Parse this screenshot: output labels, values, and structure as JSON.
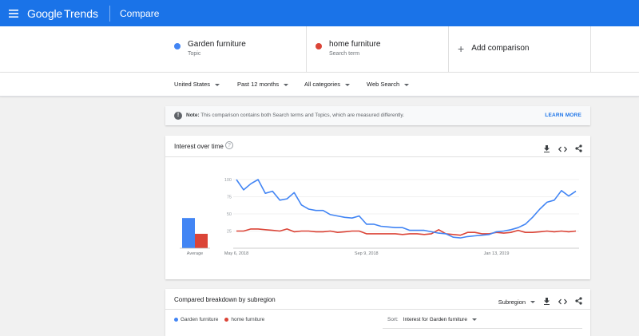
{
  "header": {
    "logo_google": "Google",
    "logo_trends": "Trends",
    "page_title": "Compare",
    "bg_color": "#1a73e8"
  },
  "terms": [
    {
      "name": "Garden furniture",
      "kind": "Topic",
      "color": "#4285f4"
    },
    {
      "name": "home furniture",
      "kind": "Search term",
      "color": "#db4437"
    }
  ],
  "add_comparison": "Add comparison",
  "filters": {
    "region": "United States",
    "period": "Past 12 months",
    "category": "All categories",
    "search_type": "Web Search"
  },
  "note": {
    "label": "Note:",
    "text": " This comparison contains both Search terms and Topics, which are measured differently.",
    "learn_more": "LEARN MORE"
  },
  "interest_over_time": {
    "title": "Interest over time",
    "help_icon": "help-circle-icon",
    "icons": [
      "download-icon",
      "embed-icon",
      "share-icon"
    ]
  },
  "chart_data": {
    "type": "line",
    "ylim": [
      0,
      100
    ],
    "yticks": [
      100,
      75,
      50,
      25
    ],
    "x_tick_labels": [
      "May 6, 2018",
      "Sep 9, 2018",
      "Jan 13, 2019"
    ],
    "x_tick_index": [
      0,
      18,
      36
    ],
    "series": [
      {
        "name": "Garden furniture",
        "color": "#4285f4",
        "average": 44,
        "values": [
          100,
          85,
          94,
          100,
          80,
          83,
          70,
          72,
          81,
          63,
          57,
          55,
          55,
          49,
          47,
          45,
          44,
          47,
          35,
          35,
          32,
          31,
          30,
          30,
          26,
          26,
          26,
          24,
          22,
          21,
          16,
          15,
          17,
          18,
          19,
          20,
          24,
          25,
          27,
          30,
          35,
          45,
          57,
          67,
          70,
          84,
          76,
          83
        ]
      },
      {
        "name": "home furniture",
        "color": "#db4437",
        "average": 21,
        "values": [
          25,
          25,
          28,
          28,
          27,
          26,
          25,
          28,
          24,
          25,
          25,
          24,
          24,
          25,
          23,
          24,
          25,
          25,
          21,
          21,
          21,
          21,
          21,
          20,
          21,
          21,
          20,
          21,
          27,
          21,
          20,
          19,
          23,
          23,
          21,
          21,
          23,
          22,
          23,
          26,
          23,
          23,
          24,
          25,
          24,
          25,
          24,
          25
        ]
      }
    ],
    "average_label": "Average"
  },
  "breakdown": {
    "title": "Compared breakdown by subregion",
    "subregion": "Subregion",
    "legend": [
      "Garden furniture",
      "home furniture"
    ],
    "sort_label": "Sort:",
    "sort_value": "Interest for Garden furniture"
  }
}
